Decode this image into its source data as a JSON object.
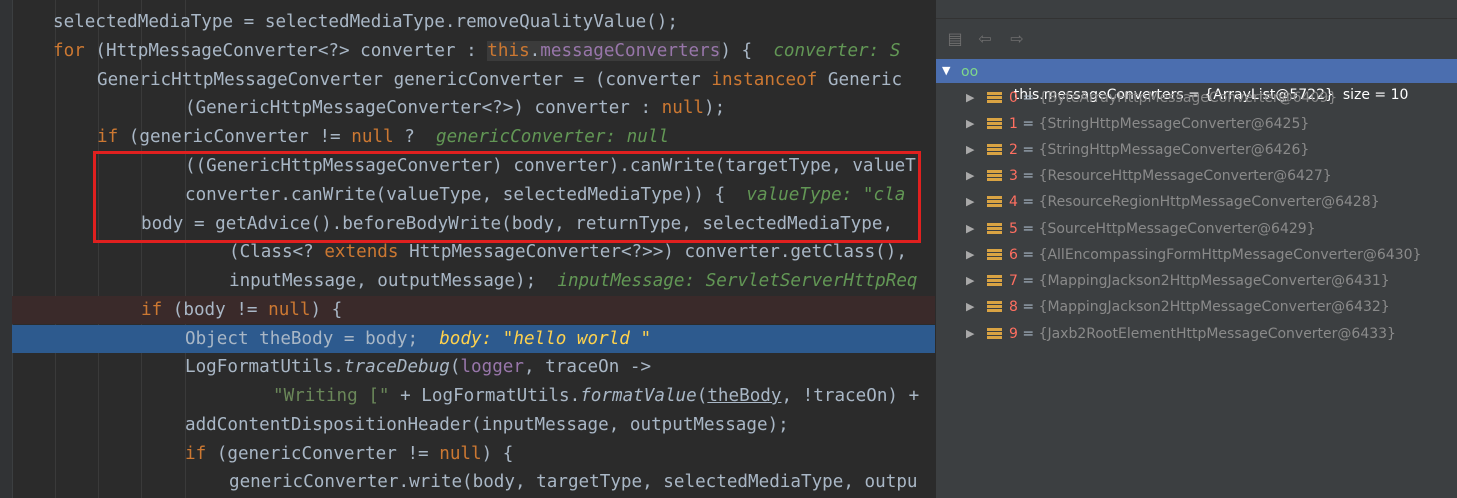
{
  "editor": {
    "lines": [
      "selectedMediaType = selectedMediaType.removeQualityValue();",
      "for (HttpMessageConverter<?> converter : this.messageConverters) {  converter: S",
      "GenericHttpMessageConverter genericConverter = (converter instanceof Generic",
      "(GenericHttpMessageConverter<?>) converter : null);",
      "if (genericConverter != null ?  genericConverter: null",
      "((GenericHttpMessageConverter) converter).canWrite(targetType, valueT",
      "converter.canWrite(valueType, selectedMediaType)) {  valueType: \"cla",
      "body = getAdvice().beforeBodyWrite(body, returnType, selectedMediaType,",
      "(Class<? extends HttpMessageConverter<?>>) converter.getClass(),",
      "inputMessage, outputMessage);  inputMessage: ServletServerHttpReq",
      "if (body != null) {",
      "Object theBody = body;  body: \"hello world \"",
      "LogFormatUtils.traceDebug(logger, traceOn ->",
      "\"Writing [\" + LogFormatUtils.formatValue(theBody, !traceOn) +",
      "addContentDispositionHeader(inputMessage, outputMessage);",
      "if (genericConverter != null) {",
      "genericConverter.write(body, targetType, selectedMediaType, outpu"
    ]
  },
  "debugger": {
    "root": {
      "name": "this.messageConverters",
      "value": "{ArrayList@5722}",
      "size_text": "size = 10"
    },
    "items": [
      {
        "index": "0",
        "value": "{ByteArrayHttpMessageConverter@6409}"
      },
      {
        "index": "1",
        "value": "{StringHttpMessageConverter@6425}"
      },
      {
        "index": "2",
        "value": "{StringHttpMessageConverter@6426}"
      },
      {
        "index": "3",
        "value": "{ResourceHttpMessageConverter@6427}"
      },
      {
        "index": "4",
        "value": "{ResourceRegionHttpMessageConverter@6428}"
      },
      {
        "index": "5",
        "value": "{SourceHttpMessageConverter@6429}"
      },
      {
        "index": "6",
        "value": "{AllEncompassingFormHttpMessageConverter@6430}"
      },
      {
        "index": "7",
        "value": "{MappingJackson2HttpMessageConverter@6431}"
      },
      {
        "index": "8",
        "value": "{MappingJackson2HttpMessageConverter@6432}"
      },
      {
        "index": "9",
        "value": "{Jaxb2RootElementHttpMessageConverter@6433}"
      }
    ],
    "icons": [
      "frames-icon",
      "back-arrow-icon",
      "forward-arrow-icon",
      "expand-arrow-icon",
      "watch-glasses-icon",
      "field-list-icon"
    ]
  },
  "colors": {
    "editor_bg": "#2b2b2b",
    "keyword": "#cc7832",
    "field": "#9876aa",
    "method": "#ffc66d",
    "inline_hint": "#629755",
    "exec_line": "#2d5a8e",
    "highlight_box": "#e0201f",
    "debug_selection": "#4b6eaf",
    "index_red": "#ff6f61"
  }
}
